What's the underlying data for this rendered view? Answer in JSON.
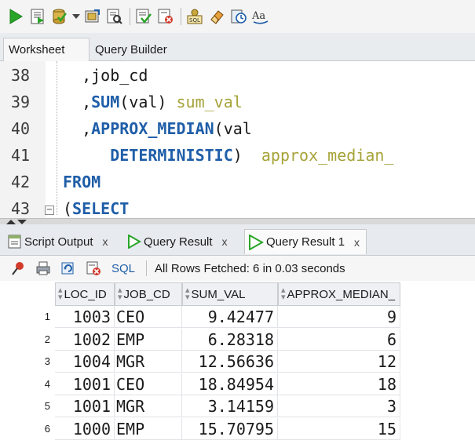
{
  "toolbar": {
    "icons": [
      "run-statement-icon",
      "run-script-icon",
      "commit-icon",
      "dropdown-caret-icon",
      "rollback-icon",
      "explain-plan-icon",
      "autotrace-icon",
      "cancel-icon",
      "sql-tuning-icon",
      "eraser-icon",
      "history-icon",
      "format-icon"
    ]
  },
  "editor_tabs": {
    "worksheet": "Worksheet",
    "query_builder": "Query Builder"
  },
  "editor": {
    "lines": [
      {
        "num": "38",
        "parts": [
          {
            "t": "  ,job_cd",
            "c": "plain"
          }
        ]
      },
      {
        "num": "39",
        "parts": [
          {
            "t": "  ,",
            "c": "plain"
          },
          {
            "t": "SUM",
            "c": "kw"
          },
          {
            "t": "(val) ",
            "c": "plain"
          },
          {
            "t": "sum_val",
            "c": "alias"
          }
        ]
      },
      {
        "num": "40",
        "parts": [
          {
            "t": "  ,",
            "c": "plain"
          },
          {
            "t": "APPROX_MEDIAN",
            "c": "kw"
          },
          {
            "t": "(val",
            "c": "plain"
          }
        ]
      },
      {
        "num": "41",
        "parts": [
          {
            "t": "     ",
            "c": "plain"
          },
          {
            "t": "DETERMINISTIC",
            "c": "kw"
          },
          {
            "t": ")  ",
            "c": "plain"
          },
          {
            "t": "approx_median_",
            "c": "alias"
          }
        ]
      },
      {
        "num": "42",
        "parts": [
          {
            "t": "FROM",
            "c": "kw"
          }
        ]
      },
      {
        "num": "43",
        "parts": [
          {
            "t": "(",
            "c": "plain"
          },
          {
            "t": "SELECT",
            "c": "kw"
          }
        ]
      }
    ]
  },
  "result_tabs": [
    {
      "label": "Script Output",
      "close": "x",
      "icon": "script-output-icon"
    },
    {
      "label": "Query Result",
      "close": "x",
      "icon": "query-result-icon"
    },
    {
      "label": "Query Result 1",
      "close": "x",
      "icon": "query-result-icon",
      "active": true
    }
  ],
  "result_toolbar": {
    "sql_label": "SQL",
    "status": "All Rows Fetched: 6 in 0.03 seconds"
  },
  "grid": {
    "columns": [
      "LOC_ID",
      "JOB_CD",
      "SUM_VAL",
      "APPROX_MEDIAN_"
    ],
    "rows": [
      {
        "n": "1",
        "loc_id": "1003",
        "job_cd": "CEO",
        "sum_val": "9.42477",
        "approx": "9"
      },
      {
        "n": "2",
        "loc_id": "1002",
        "job_cd": "EMP",
        "sum_val": "6.28318",
        "approx": "6"
      },
      {
        "n": "3",
        "loc_id": "1004",
        "job_cd": "MGR",
        "sum_val": "12.56636",
        "approx": "12"
      },
      {
        "n": "4",
        "loc_id": "1001",
        "job_cd": "CEO",
        "sum_val": "18.84954",
        "approx": "18"
      },
      {
        "n": "5",
        "loc_id": "1001",
        "job_cd": "MGR",
        "sum_val": "3.14159",
        "approx": "3"
      },
      {
        "n": "6",
        "loc_id": "1000",
        "job_cd": "EMP",
        "sum_val": "15.70795",
        "approx": "15"
      }
    ]
  },
  "colors": {
    "keyword": "#1f5ea8",
    "alias": "#a6a33a",
    "run_green": "#2aa52a"
  }
}
